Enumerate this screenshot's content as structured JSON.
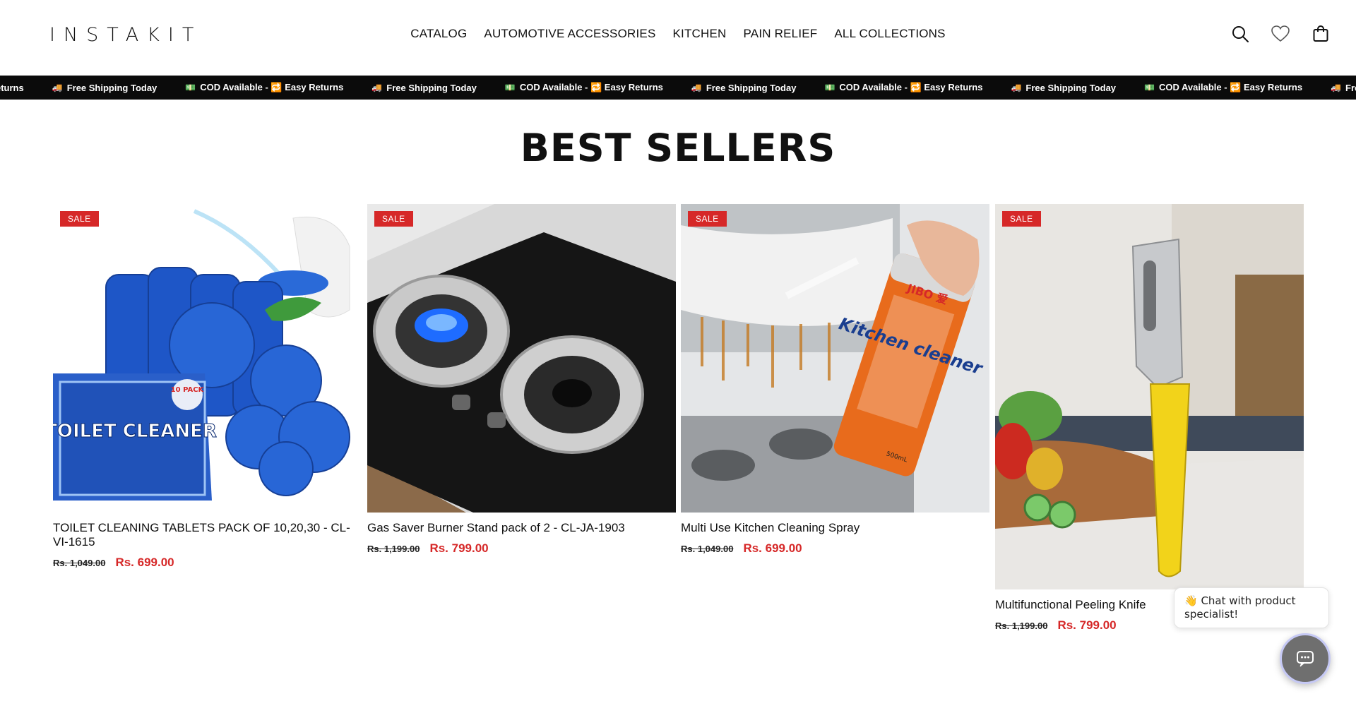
{
  "brand": {
    "logo_text": "INSTAKIT"
  },
  "nav": {
    "items": [
      {
        "label": "CATALOG"
      },
      {
        "label": "AUTOMOTIVE ACCESSORIES"
      },
      {
        "label": "KITCHEN"
      },
      {
        "label": "PAIN RELIEF"
      },
      {
        "label": "ALL COLLECTIONS"
      }
    ]
  },
  "header_icons": [
    "search-icon",
    "heart-icon",
    "shopping-bag-icon"
  ],
  "marquee": {
    "items": [
      {
        "emoji": "",
        "text": "eturns"
      },
      {
        "emoji": "🚚",
        "text": "Free Shipping Today"
      },
      {
        "emoji": "💵",
        "text": "COD Available - 🔁 Easy Returns"
      },
      {
        "emoji": "🚚",
        "text": "Free Shipping Today"
      },
      {
        "emoji": "💵",
        "text": "COD Available - 🔁 Easy Returns"
      },
      {
        "emoji": "🚚",
        "text": "Free Shipping Today"
      },
      {
        "emoji": "💵",
        "text": "COD Available - 🔁 Easy Returns"
      },
      {
        "emoji": "🚚",
        "text": "Free Shipping Today"
      },
      {
        "emoji": "💵",
        "text": "COD Available - 🔁 Easy Returns"
      },
      {
        "emoji": "🚚",
        "text": "Free Shipping To"
      }
    ]
  },
  "section": {
    "title": "BEST SELLERS"
  },
  "products": [
    {
      "badge": "SALE",
      "title": "TOILET CLEANING TABLETS PACK OF 10,20,30 - CL-VI-1615",
      "price_old": "Rs. 1,049.00",
      "price_new": "Rs. 699.00"
    },
    {
      "badge": "SALE",
      "title": "Gas Saver Burner Stand pack of 2 - CL-JA-1903",
      "price_old": "Rs. 1,199.00",
      "price_new": "Rs. 799.00"
    },
    {
      "badge": "SALE",
      "title": "Multi Use Kitchen Cleaning Spray",
      "price_old": "Rs. 1,049.00",
      "price_new": "Rs. 699.00"
    },
    {
      "badge": "SALE",
      "title": "Multifunctional Peeling Knife",
      "price_old": "Rs. 1,199.00",
      "price_new": "Rs. 799.00"
    }
  ],
  "product_image_text": {
    "toilet": {
      "pack": "10 PACK",
      "name": "TOILET CLEANER"
    },
    "spray": {
      "brand": "JIBO 爱",
      "name": "Kitchen cleaner",
      "volume": "500mL"
    }
  },
  "chat": {
    "bubble_text": "👋 Chat with product specialist!",
    "launcher_icon": "chat-icon"
  },
  "colors": {
    "sale_red": "#d62828",
    "marquee_bg": "#0b0b0b",
    "text": "#111111"
  }
}
